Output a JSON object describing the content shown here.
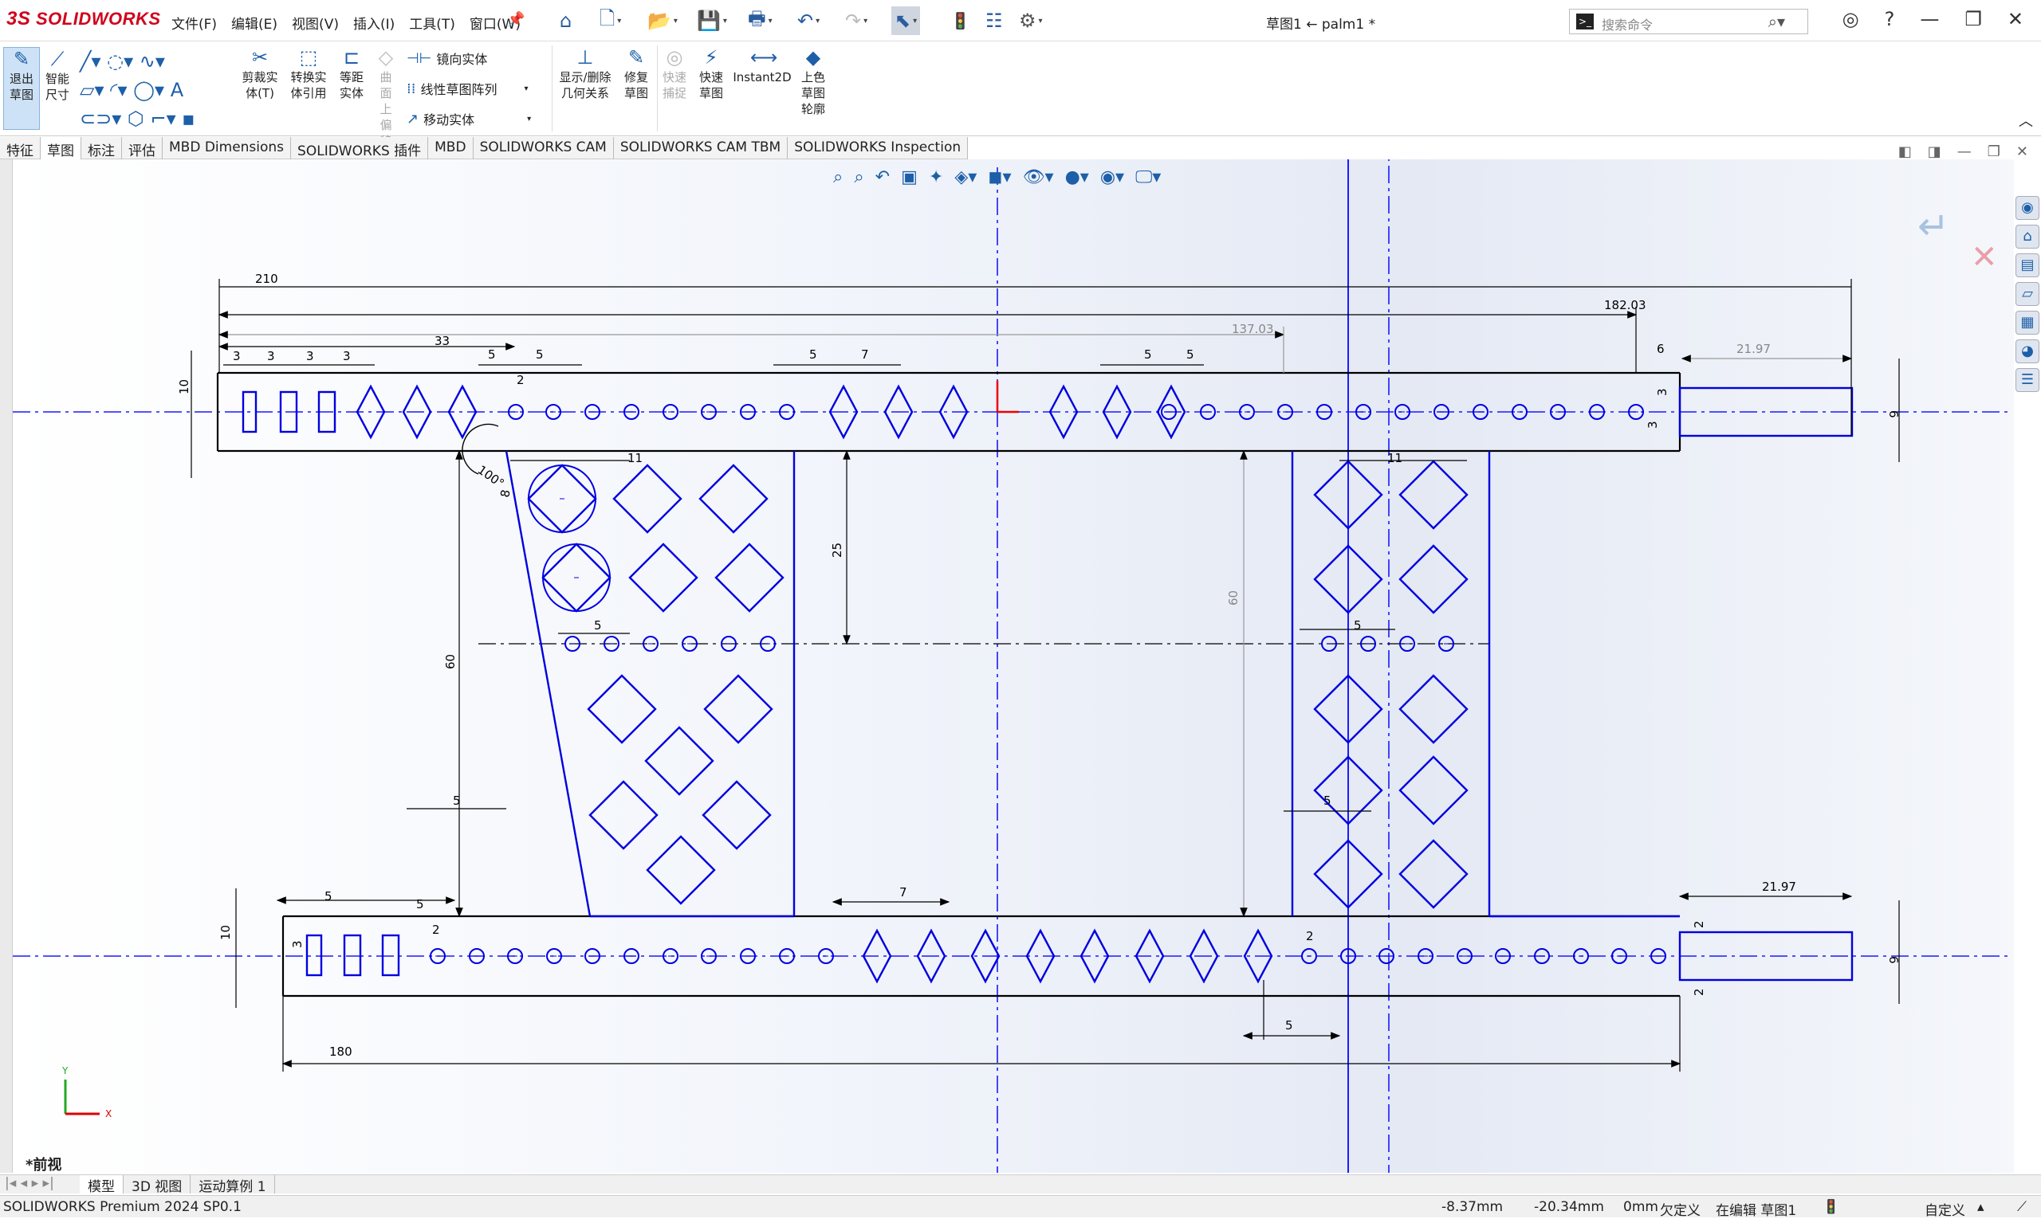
{
  "app": {
    "brand": "SOLIDWORKS",
    "brand_prefix": "3S"
  },
  "menu": [
    "文件(F)",
    "编辑(E)",
    "视图(V)",
    "插入(I)",
    "工具(T)",
    "窗口(W)"
  ],
  "document_title": "草图1 ← palm1 *",
  "search": {
    "placeholder": "搜索命令"
  },
  "ribbon": {
    "exit_sketch": "退出草图",
    "smart_dim": "智能尺寸",
    "trim": "剪裁实体(T)",
    "convert": "转换实体引用",
    "offset": "等距实体",
    "surface_offset": "曲面上偏移",
    "mirror": "镜向实体",
    "linear_pattern": "线性草图阵列",
    "move": "移动实体",
    "relations": "显示/删除几何关系",
    "repair": "修复草图",
    "rapid_snaps": "快速捕捉",
    "rapid_sketch": "快速草图",
    "instant2d": "Instant2D",
    "shaded_contours": "上色草图轮廓"
  },
  "tabs": [
    "特征",
    "草图",
    "标注",
    "评估",
    "MBD Dimensions",
    "SOLIDWORKS 插件",
    "MBD",
    "SOLIDWORKS CAM",
    "SOLIDWORKS CAM TBM",
    "SOLIDWORKS Inspection"
  ],
  "active_tab": "草图",
  "view_name": "*前视",
  "bottom_tabs": [
    "模型",
    "3D 视图",
    "运动算例 1"
  ],
  "status": {
    "product": "SOLIDWORKS Premium 2024 SP0.1",
    "x": "-8.37mm",
    "y": "-20.34mm",
    "z": "0mm",
    "definition": "欠定义",
    "editing": "在编辑 草图1",
    "units": "自定义"
  },
  "dimensions": {
    "d210": "210",
    "d182": "182.03",
    "d137": "137.03",
    "d33": "33",
    "d3a": "3",
    "d3b": "3",
    "d3c": "3",
    "d5a": "5",
    "d5b": "5",
    "d5c": "5",
    "d7a": "7",
    "d5d": "5",
    "d5e": "5",
    "d6": "6",
    "d2197a": "21.97",
    "d10a": "10",
    "d2a": "2",
    "d3d": "3",
    "d3e": "3",
    "d6b": "6",
    "d11a": "11",
    "d11b": "11",
    "d100": "100°",
    "d8": "8",
    "d25": "25",
    "d60a": "60",
    "d60b": "60",
    "d5f": "5",
    "d5g": "5",
    "d5h": "5",
    "d5i": "5",
    "d5j": "5",
    "d5k": "5",
    "d7b": "7",
    "d2b": "2",
    "d2c": "2",
    "d2197b": "21.97",
    "d10b": "10",
    "d6c": "6",
    "d3f": "3",
    "d5l": "5",
    "d180": "180",
    "d2d": "2",
    "d2e": "2",
    "d5m": "5"
  },
  "colors": {
    "sketch": "#0000e0",
    "dimension": "#000000",
    "centerline": "#1a1aff",
    "accent": "#d0021b"
  }
}
